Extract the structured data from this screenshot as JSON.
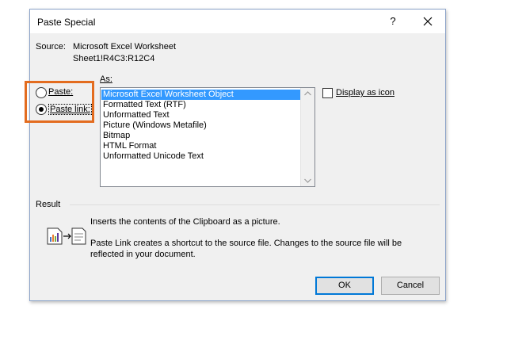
{
  "dialog": {
    "title": "Paste Special",
    "help_glyph": "?",
    "source_label": "Source:",
    "source_line1": "Microsoft Excel Worksheet",
    "source_line2": "Sheet1!R4C3:R12C4",
    "as_label": "As:",
    "paste_option": "Paste:",
    "paste_link_option": "Paste link:",
    "selected_option": "Paste link:",
    "list_items": [
      "Microsoft Excel Worksheet Object",
      "Formatted Text (RTF)",
      "Unformatted Text",
      "Picture (Windows Metafile)",
      "Bitmap",
      "HTML Format",
      "Unformatted Unicode Text"
    ],
    "selected_item": "Microsoft Excel Worksheet Object",
    "display_as_icon_label": "Display as icon",
    "display_as_icon_checked": false,
    "result_label": "Result",
    "result_line1": "Inserts the contents of the Clipboard as a picture.",
    "result_line2": "Paste Link creates a shortcut to the source file. Changes to the source file will be",
    "result_line3": "reflected in your document.",
    "ok_label": "OK",
    "cancel_label": "Cancel"
  },
  "colors": {
    "selection": "#3399ff",
    "highlight_box": "#e36c1f",
    "dialog_bg": "#f0f0f0"
  },
  "icons": [
    "close-icon",
    "result-paste-link-icon",
    "scroll-up-icon",
    "scroll-down-icon"
  ]
}
